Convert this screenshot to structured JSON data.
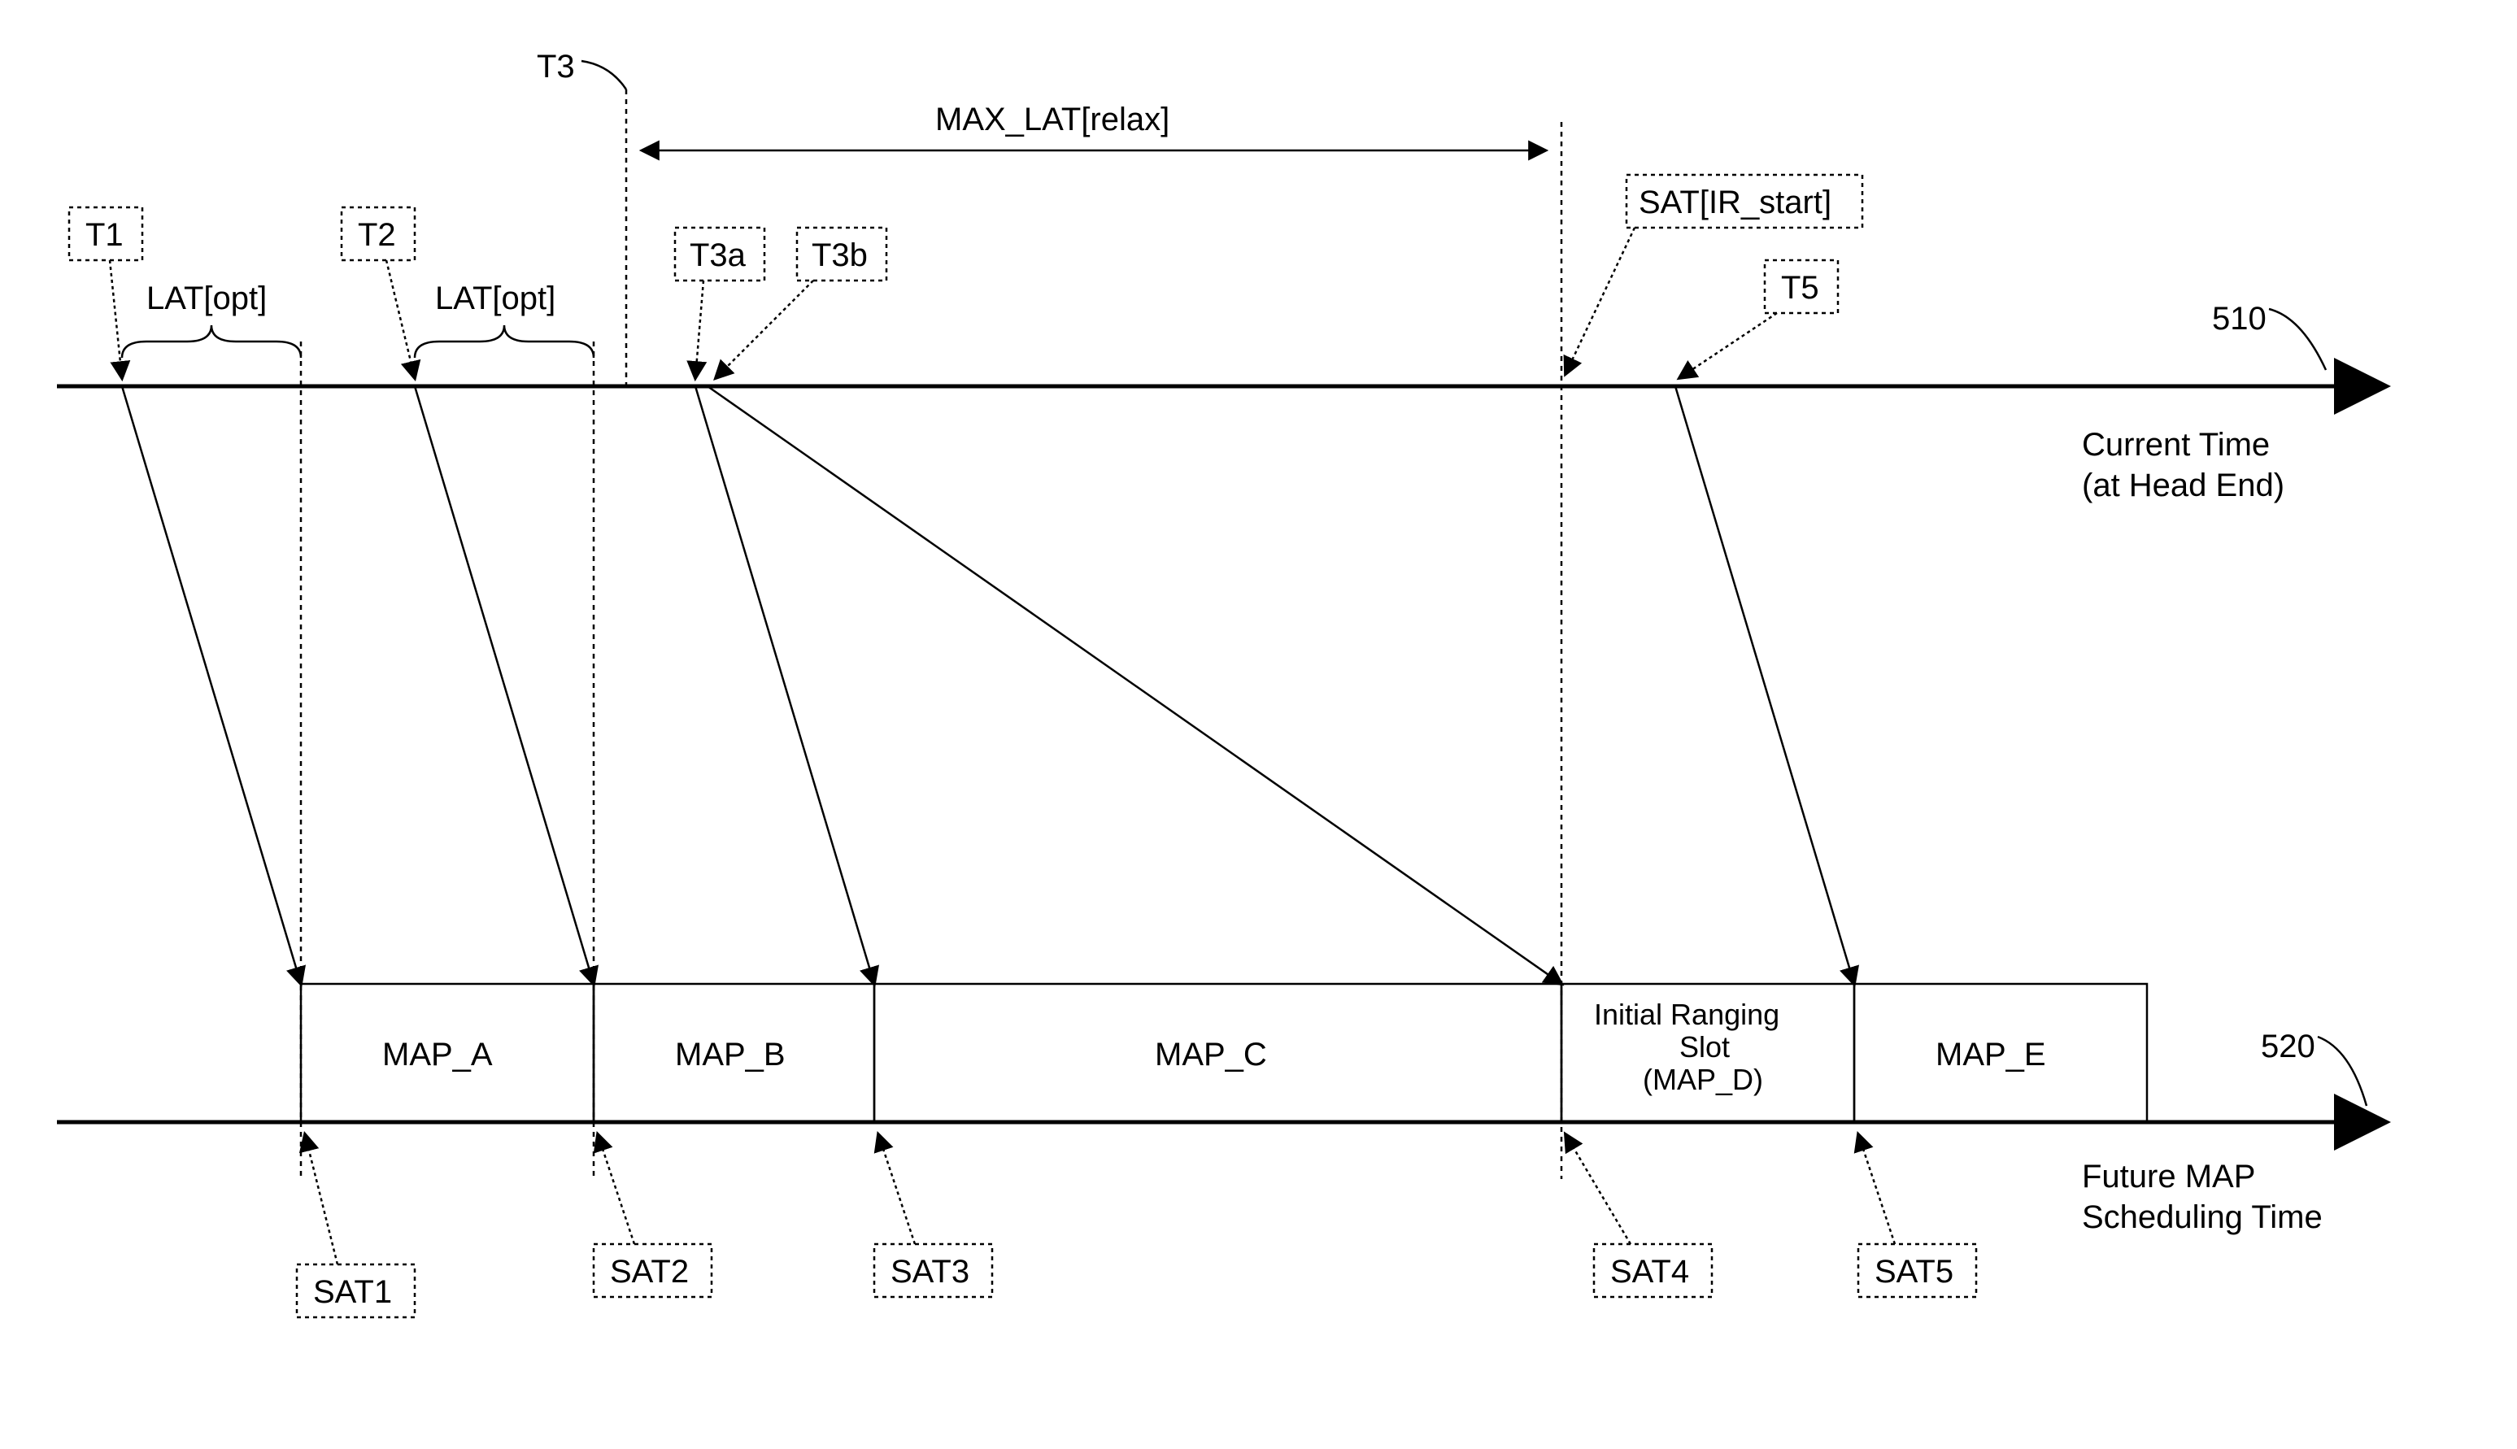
{
  "labels": {
    "t1": "T1",
    "t2": "T2",
    "t3": "T3",
    "t3a": "T3a",
    "t3b": "T3b",
    "t5": "T5",
    "lat_opt_1": "LAT[opt]",
    "lat_opt_2": "LAT[opt]",
    "max_lat": "MAX_LAT[relax]",
    "sat_ir": "SAT[IR_start]",
    "ref_510": "510",
    "ref_520": "520",
    "top_axis_1": "Current Time",
    "top_axis_2": "(at Head End)",
    "bot_axis_1": "Future  MAP",
    "bot_axis_2": "Scheduling Time",
    "map_a": "MAP_A",
    "map_b": "MAP_B",
    "map_c": "MAP_C",
    "map_d_1": "Initial Ranging",
    "map_d_2": "Slot",
    "map_d_3": "(MAP_D)",
    "map_e": "MAP_E",
    "sat1": "SAT1",
    "sat2": "SAT2",
    "sat3": "SAT3",
    "sat4": "SAT4",
    "sat5": "SAT5"
  },
  "chart_data": {
    "type": "timing-diagram",
    "top_axis": {
      "label": "Current Time (at Head End)",
      "ref": "510",
      "events": [
        "T1",
        "T2",
        "T3",
        "T3a",
        "T3b",
        "T5"
      ],
      "spans": [
        {
          "name": "LAT[opt]",
          "from": "T1",
          "to": "SAT1-projection"
        },
        {
          "name": "LAT[opt]",
          "from": "T2",
          "to": "SAT2-projection"
        },
        {
          "name": "MAX_LAT[relax]",
          "from": "T3",
          "to": "SAT[IR_start]"
        }
      ]
    },
    "bottom_axis": {
      "label": "Future MAP Scheduling Time",
      "ref": "520",
      "sats": [
        "SAT1",
        "SAT2",
        "SAT3",
        "SAT4",
        "SAT5"
      ],
      "maps": [
        {
          "name": "MAP_A",
          "from": "SAT1",
          "to": "SAT2"
        },
        {
          "name": "MAP_B",
          "from": "SAT2",
          "to": "SAT3"
        },
        {
          "name": "MAP_C",
          "from": "SAT3",
          "to": "SAT4"
        },
        {
          "name": "Initial Ranging Slot (MAP_D)",
          "from": "SAT4",
          "to": "SAT5"
        },
        {
          "name": "MAP_E",
          "from": "SAT5",
          "to": "end"
        }
      ]
    },
    "mappings": [
      {
        "from_top": "T1",
        "to_bottom_map": "MAP_A"
      },
      {
        "from_top": "T2",
        "to_bottom_map": "MAP_B"
      },
      {
        "from_top": "T3a",
        "to_bottom_map": "MAP_C"
      },
      {
        "from_top": "T3b",
        "to_bottom_map": "MAP_D"
      },
      {
        "from_top": "T5",
        "to_bottom_map": "MAP_E"
      }
    ]
  }
}
